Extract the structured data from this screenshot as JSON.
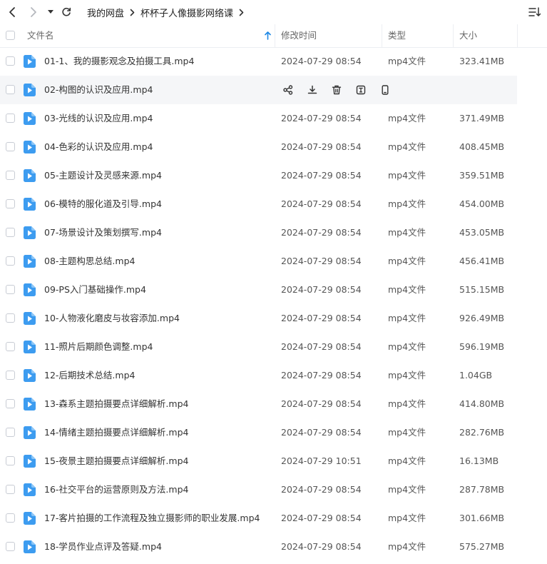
{
  "breadcrumb": [
    "我的网盘",
    "杯杯子人像摄影网络课"
  ],
  "columns": {
    "name": "文件名",
    "modified": "修改时间",
    "type": "类型",
    "size": "大小"
  },
  "colors": {
    "accent": "#1e88e5",
    "file_icon": "#3d9cf0",
    "hover_row": "#f5f6f8"
  },
  "hovered_row_index": 1,
  "hover_actions": [
    "share-icon",
    "download-icon",
    "delete-icon",
    "rename-icon",
    "phone-icon"
  ],
  "files": [
    {
      "name": "01-1、我的摄影观念及拍摄工具.mp4",
      "date": "2024-07-29 08:54",
      "type": "mp4文件",
      "size": "323.41MB"
    },
    {
      "name": "02-构图的认识及应用.mp4",
      "date": "",
      "type": "",
      "size": ""
    },
    {
      "name": "03-光线的认识及应用.mp4",
      "date": "2024-07-29 08:54",
      "type": "mp4文件",
      "size": "371.49MB"
    },
    {
      "name": "04-色彩的认识及应用.mp4",
      "date": "2024-07-29 08:54",
      "type": "mp4文件",
      "size": "408.45MB"
    },
    {
      "name": "05-主题设计及灵感来源.mp4",
      "date": "2024-07-29 08:54",
      "type": "mp4文件",
      "size": "359.51MB"
    },
    {
      "name": "06-模特的服化道及引导.mp4",
      "date": "2024-07-29 08:54",
      "type": "mp4文件",
      "size": "454.00MB"
    },
    {
      "name": "07-场景设计及策划撰写.mp4",
      "date": "2024-07-29 08:54",
      "type": "mp4文件",
      "size": "453.05MB"
    },
    {
      "name": "08-主题构思总结.mp4",
      "date": "2024-07-29 08:54",
      "type": "mp4文件",
      "size": "456.41MB"
    },
    {
      "name": "09-PS入门基础操作.mp4",
      "date": "2024-07-29 08:54",
      "type": "mp4文件",
      "size": "515.15MB"
    },
    {
      "name": "10-人物液化磨皮与妆容添加.mp4",
      "date": "2024-07-29 08:54",
      "type": "mp4文件",
      "size": "926.49MB"
    },
    {
      "name": "11-照片后期颜色调整.mp4",
      "date": "2024-07-29 08:54",
      "type": "mp4文件",
      "size": "596.19MB"
    },
    {
      "name": "12-后期技术总结.mp4",
      "date": "2024-07-29 08:54",
      "type": "mp4文件",
      "size": "1.04GB"
    },
    {
      "name": "13-森系主题拍摄要点详细解析.mp4",
      "date": "2024-07-29 08:54",
      "type": "mp4文件",
      "size": "414.80MB"
    },
    {
      "name": "14-情绪主题拍摄要点详细解析.mp4",
      "date": "2024-07-29 08:54",
      "type": "mp4文件",
      "size": "282.76MB"
    },
    {
      "name": "15-夜景主题拍摄要点详细解析.mp4",
      "date": "2024-07-29 10:51",
      "type": "mp4文件",
      "size": "16.13MB"
    },
    {
      "name": "16-社交平台的运营原则及方法.mp4",
      "date": "2024-07-29 08:54",
      "type": "mp4文件",
      "size": "287.78MB"
    },
    {
      "name": "17-客片拍摄的工作流程及独立摄影师的职业发展.mp4",
      "date": "2024-07-29 08:54",
      "type": "mp4文件",
      "size": "301.66MB"
    },
    {
      "name": "18-学员作业点评及答疑.mp4",
      "date": "2024-07-29 08:54",
      "type": "mp4文件",
      "size": "575.27MB"
    }
  ]
}
